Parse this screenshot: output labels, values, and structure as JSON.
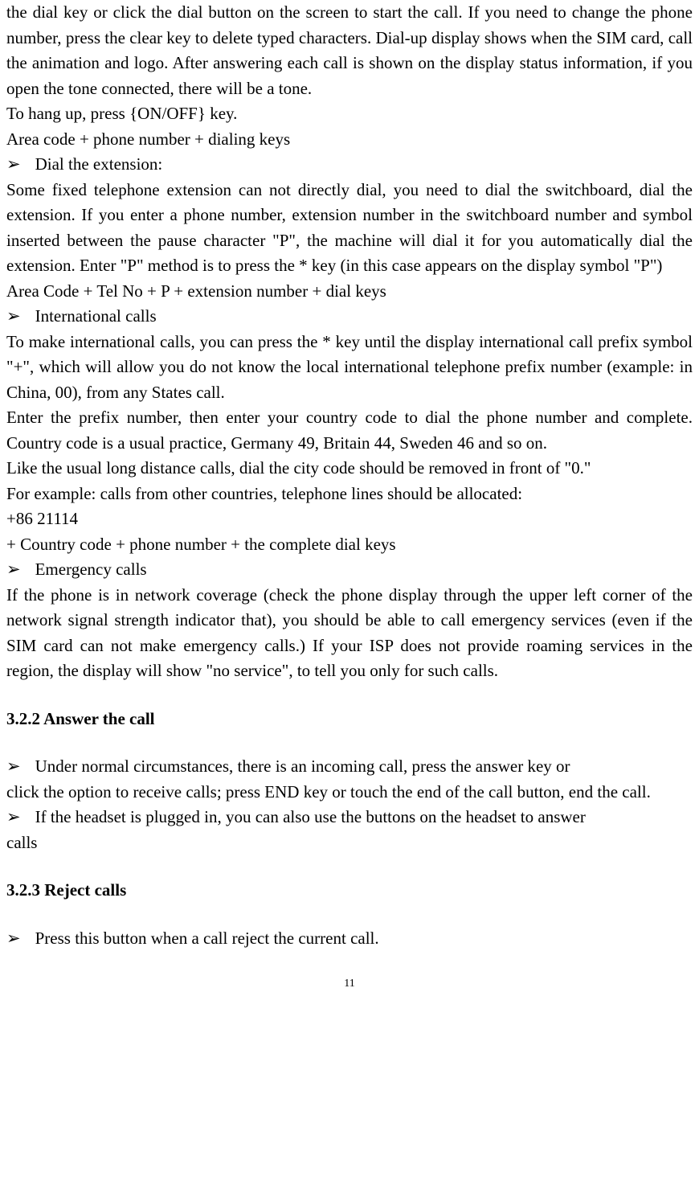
{
  "p1": "the dial key or click the dial button on the screen to start the call. If you need to change the phone number, press the clear key to delete typed characters. Dial-up display shows when the SIM card, call the animation and logo. After answering each call is shown on the display status information, if you open the tone connected, there will be a tone.",
  "p2": "To hang up, press {ON/OFF} key.",
  "p3": "Area code + phone number + dialing keys",
  "bullet1": "Dial the extension:",
  "p4": "Some fixed telephone extension can not directly dial, you need to dial the switchboard, dial the extension. If you enter a phone number, extension number in the switchboard number and symbol inserted between the pause character \"P\", the machine will dial it for you automatically dial the extension. Enter \"P\" method is to press the * key (in this case appears on the display symbol \"P\")",
  "p5": "Area Code + Tel No + P + extension number + dial keys",
  "bullet2": "International calls",
  "p6": "To make international calls, you can press the * key until the display international call prefix symbol \"+\", which will allow you do not know the local international telephone prefix number (example: in China, 00), from any States call.",
  "p7": "Enter the prefix number, then enter your country code to dial the phone number and complete. Country code is a usual practice, Germany 49, Britain 44, Sweden 46 and so on.",
  "p8": "Like the usual long distance calls, dial the city code should be removed in front of \"0.\"",
  "p9": "For example: calls from other countries, telephone lines should be allocated:",
  "p10": "+86 21114",
  "p11": "+ Country code + phone number + the complete dial keys",
  "bullet3": "Emergency calls",
  "p12": "If the phone is in network coverage (check the phone display through the upper left corner of the network signal strength indicator that), you should be able to call emergency services (even if the SIM card can not make emergency calls.) If your ISP does not provide roaming services in the region, the display will show \"no service\", to tell you only for such calls.",
  "heading1": "3.2.2 Answer the call",
  "bullet4_start": "Under normal circumstances, there is an incoming call, press the answer key or",
  "bullet4_cont": "click the option to receive calls; press END key or touch the end of the call button, end the call.",
  "bullet5_start": "If the headset is plugged in, you can also use the buttons on the headset to answer",
  "bullet5_cont": "calls",
  "heading2": "3.2.3 Reject calls",
  "bullet6": "Press this button when a call reject the current call.",
  "marker": "➢",
  "pageNum": "11"
}
